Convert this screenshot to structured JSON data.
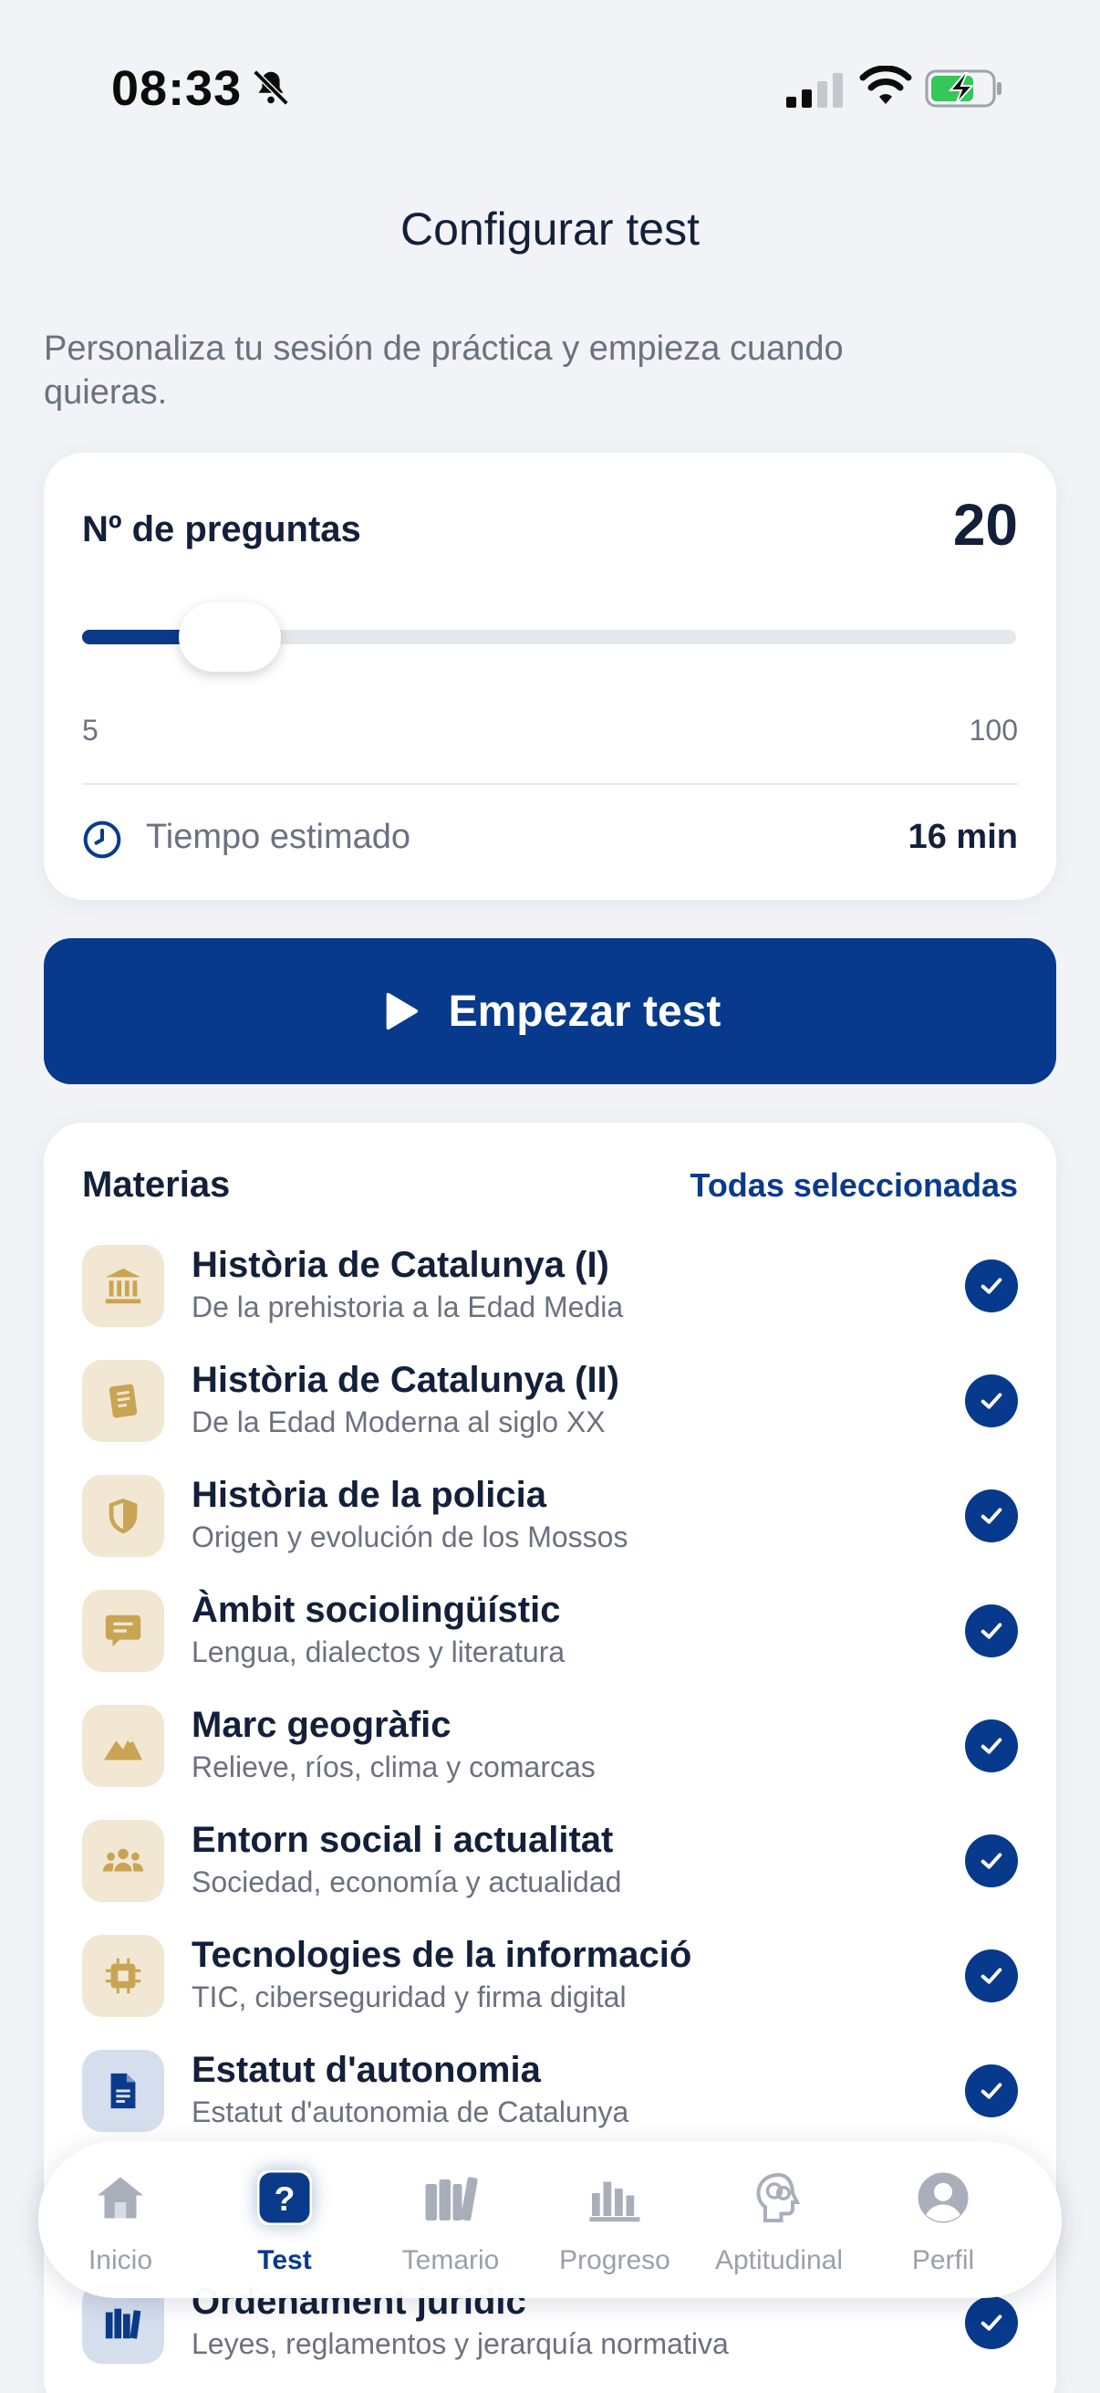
{
  "status_bar": {
    "time": "08:33",
    "icons": [
      "bell-slash-icon",
      "cellular-signal-icon",
      "wifi-icon",
      "battery-charging-icon"
    ]
  },
  "header": {
    "title": "Configurar test"
  },
  "intro": {
    "text": "Personaliza tu sesión de práctica y empieza cuando quieras."
  },
  "questions": {
    "label": "Nº de preguntas",
    "value": "20",
    "slider_fraction": 0.158,
    "min": "5",
    "max": "100",
    "estimate_label": "Tiempo estimado",
    "estimate_value": "16 min"
  },
  "start_button": {
    "label": "Empezar test",
    "icon": "play-icon"
  },
  "subjects": {
    "title": "Materias",
    "select_all_label": "Todas seleccionadas",
    "items": [
      {
        "name": "Història de Catalunya (I)",
        "desc": "De la prehistoria a la Edad Media",
        "icon": "museum-icon",
        "selected": true
      },
      {
        "name": "Història de Catalunya (II)",
        "desc": "De la Edad Moderna al siglo XX",
        "icon": "book-icon",
        "selected": true
      },
      {
        "name": "Història de la policia",
        "desc": "Origen y evolución de los Mossos",
        "icon": "shield-icon",
        "selected": true
      },
      {
        "name": "Àmbit sociolingüístic",
        "desc": "Lengua, dialectos y literatura",
        "icon": "chat-bubble-icon",
        "selected": true
      },
      {
        "name": "Marc geogràfic",
        "desc": "Relieve, ríos, clima y comarcas",
        "icon": "mountains-icon",
        "selected": true
      },
      {
        "name": "Entorn social i actualitat",
        "desc": "Sociedad, economía y actualidad",
        "icon": "people-icon",
        "selected": true
      },
      {
        "name": "Tecnologies de la informació",
        "desc": "TIC, ciberseguridad y firma digital",
        "icon": "chip-icon",
        "selected": true
      },
      {
        "name": "Estatut d'autonomia",
        "desc": "Estatut d'autonomia de Catalunya",
        "icon": "document-icon",
        "selected": true
      },
      {
        "name": "Ordenament jurídic",
        "desc": "Leyes, reglamentos y jerarquía normativa",
        "icon": "law-books-icon",
        "selected": true
      }
    ]
  },
  "tabbar": {
    "active": "Test",
    "tabs": [
      {
        "label": "Inicio",
        "icon": "home-icon"
      },
      {
        "label": "Test",
        "icon": "question-icon"
      },
      {
        "label": "Temario",
        "icon": "books-icon"
      },
      {
        "label": "Progreso",
        "icon": "bar-chart-icon"
      },
      {
        "label": "Aptitudinal",
        "icon": "brain-icon"
      },
      {
        "label": "Perfil",
        "icon": "user-icon"
      }
    ]
  },
  "colors": {
    "primary": "#07398c",
    "accent_bg": "#f1e7d2",
    "accent_icon": "#c9a453",
    "muted_text": "#6b7180",
    "background": "#f2f3f6"
  }
}
